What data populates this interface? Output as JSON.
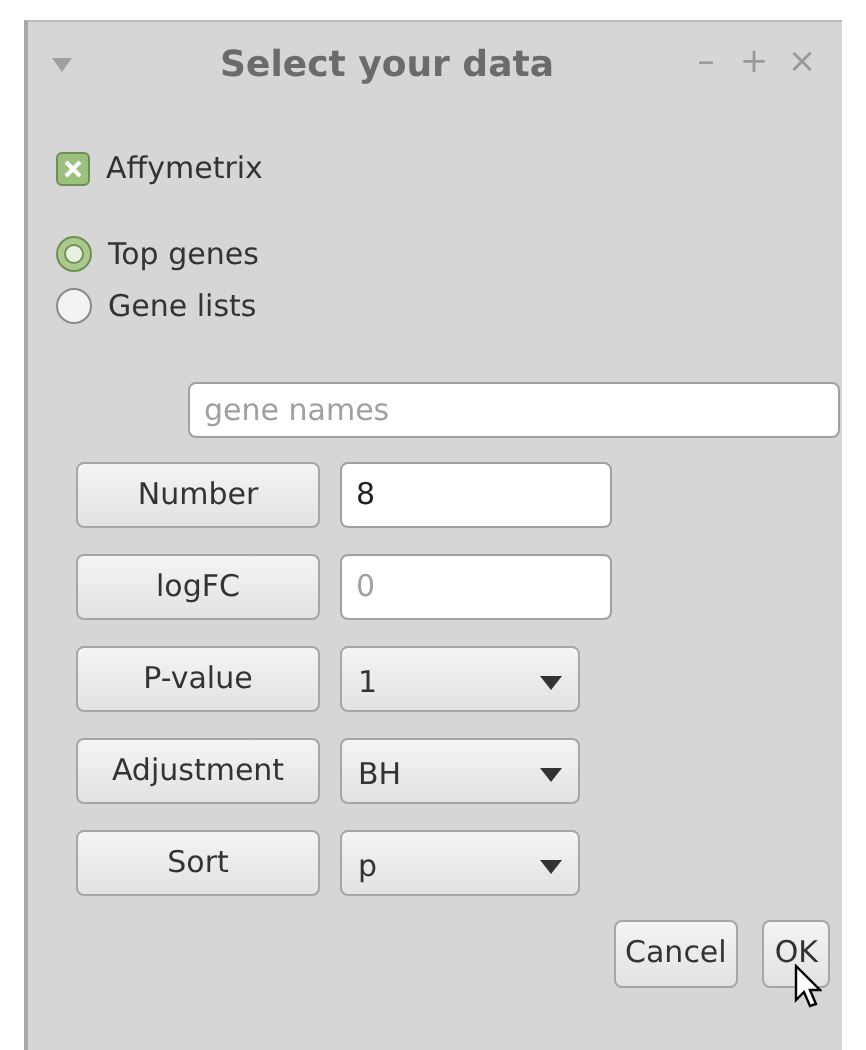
{
  "window": {
    "title": "Select your data",
    "controls": [
      "–",
      "+",
      "×"
    ]
  },
  "affymetrix": {
    "label": "Affymetrix",
    "checked": true
  },
  "radios": [
    {
      "label": "Top genes",
      "selected": true
    },
    {
      "label": "Gene lists",
      "selected": false
    }
  ],
  "gene_names": {
    "placeholder": "gene names"
  },
  "params": [
    {
      "kind": "input",
      "button": "Number",
      "value": "8"
    },
    {
      "kind": "input",
      "button": "logFC",
      "placeholder": "0"
    },
    {
      "kind": "select",
      "button": "P-value",
      "value": "1"
    },
    {
      "kind": "select",
      "button": "Adjustment",
      "value": "BH"
    },
    {
      "kind": "select",
      "button": "Sort",
      "value": "p"
    }
  ],
  "buttons": [
    "Cancel",
    "OK"
  ]
}
